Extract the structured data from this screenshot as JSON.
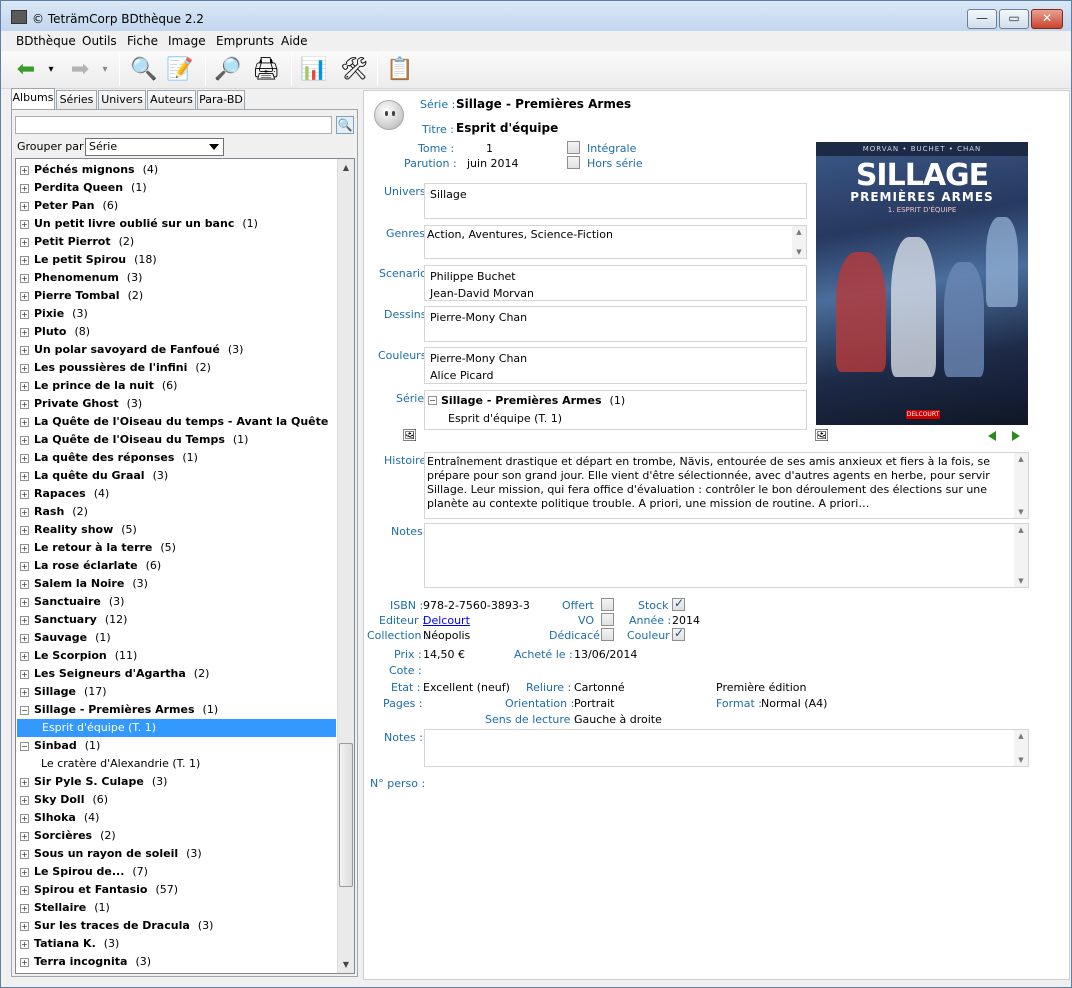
{
  "window": {
    "title": "© TeträmCorp BDthèque 2.2",
    "btn_min": "—",
    "btn_max": "▭",
    "btn_close": "✕"
  },
  "menu": [
    "BDthèque",
    "Outils",
    "Fiche",
    "Image",
    "Emprunts",
    "Aide"
  ],
  "toolbar": {
    "icons": [
      "back-arrow-icon",
      "forward-arrow-icon",
      "search-icon",
      "edit-icon",
      "preview-icon",
      "print-icon",
      "stats-icon",
      "tools-icon",
      "notes-icon"
    ],
    "glyphs": {
      "back": "⬅",
      "back_dd": "▾",
      "forward": "➡",
      "forward_dd": "▾",
      "search": "🔍",
      "edit": "📝",
      "preview": "🔎",
      "print": "🖨",
      "stats": "📊",
      "tools": "🛠",
      "notes": "📋"
    }
  },
  "tabs": [
    "Albums",
    "Séries",
    "Univers",
    "Auteurs",
    "Para-BD"
  ],
  "left": {
    "search_value": "",
    "search_btn": "🔍",
    "group_label": "Grouper par",
    "group_value": "Série",
    "tree": [
      {
        "name": "Péchés mignons",
        "count": "(4)",
        "state": "+"
      },
      {
        "name": "Perdita Queen",
        "count": "(1)",
        "state": "+"
      },
      {
        "name": "Peter Pan",
        "count": "(6)",
        "state": "+"
      },
      {
        "name": "Un petit livre oublié sur un banc",
        "count": "(1)",
        "state": "+"
      },
      {
        "name": "Petit Pierrot",
        "count": "(2)",
        "state": "+"
      },
      {
        "name": "Le petit Spirou",
        "count": "(18)",
        "state": "+"
      },
      {
        "name": "Phenomenum",
        "count": "(3)",
        "state": "+"
      },
      {
        "name": "Pierre Tombal",
        "count": "(2)",
        "state": "+"
      },
      {
        "name": "Pixie",
        "count": "(3)",
        "state": "+"
      },
      {
        "name": "Pluto",
        "count": "(8)",
        "state": "+"
      },
      {
        "name": "Un polar savoyard de Fanfoué",
        "count": "(3)",
        "state": "+"
      },
      {
        "name": "Les poussières de l'infini",
        "count": "(2)",
        "state": "+"
      },
      {
        "name": "Le prince de la nuit",
        "count": "(6)",
        "state": "+"
      },
      {
        "name": "Private Ghost",
        "count": "(3)",
        "state": "+"
      },
      {
        "name": "La Quête de l'Oiseau du temps - Avant la Quête",
        "count": "(4)",
        "state": "+"
      },
      {
        "name": "La Quête de l'Oiseau du Temps",
        "count": "(1)",
        "state": "+"
      },
      {
        "name": "La quête des réponses",
        "count": "(1)",
        "state": "+"
      },
      {
        "name": "La quête du Graal",
        "count": "(3)",
        "state": "+"
      },
      {
        "name": "Rapaces",
        "count": "(4)",
        "state": "+"
      },
      {
        "name": "Rash",
        "count": "(2)",
        "state": "+"
      },
      {
        "name": "Reality show",
        "count": "(5)",
        "state": "+"
      },
      {
        "name": "Le retour à la terre",
        "count": "(5)",
        "state": "+"
      },
      {
        "name": "La rose éclarlate",
        "count": "(6)",
        "state": "+"
      },
      {
        "name": "Salem la Noire",
        "count": "(3)",
        "state": "+"
      },
      {
        "name": "Sanctuaire",
        "count": "(3)",
        "state": "+"
      },
      {
        "name": "Sanctuary",
        "count": "(12)",
        "state": "+"
      },
      {
        "name": "Sauvage",
        "count": "(1)",
        "state": "+"
      },
      {
        "name": "Le Scorpion",
        "count": "(11)",
        "state": "+"
      },
      {
        "name": "Les Seigneurs d'Agartha",
        "count": "(2)",
        "state": "+"
      },
      {
        "name": "Sillage",
        "count": "(17)",
        "state": "+"
      },
      {
        "name": "Sillage - Premières Armes",
        "count": "(1)",
        "state": "-"
      },
      {
        "name": "Esprit d'équipe (T. 1)",
        "count": "",
        "state": "child-selected"
      },
      {
        "name": "Sinbad",
        "count": "(1)",
        "state": "-"
      },
      {
        "name": "Le cratère d'Alexandrie (T. 1)",
        "count": "",
        "state": "child"
      },
      {
        "name": "Sir Pyle S. Culape",
        "count": "(3)",
        "state": "+"
      },
      {
        "name": "Sky Doll",
        "count": "(6)",
        "state": "+"
      },
      {
        "name": "Slhoka",
        "count": "(4)",
        "state": "+"
      },
      {
        "name": "Sorcières",
        "count": "(2)",
        "state": "+"
      },
      {
        "name": "Sous un rayon de soleil",
        "count": "(3)",
        "state": "+"
      },
      {
        "name": "Le Spirou de...",
        "count": "(7)",
        "state": "+"
      },
      {
        "name": "Spirou et Fantasio",
        "count": "(57)",
        "state": "+"
      },
      {
        "name": "Stellaire",
        "count": "(1)",
        "state": "+"
      },
      {
        "name": "Sur les traces de Dracula",
        "count": "(3)",
        "state": "+"
      },
      {
        "name": "Tatiana K.",
        "count": "(3)",
        "state": "+"
      },
      {
        "name": "Terra incognita",
        "count": "(3)",
        "state": "+"
      }
    ]
  },
  "detail": {
    "serie_label": "Série :",
    "serie_value": "Sillage - Premières Armes",
    "titre_label": "Titre :",
    "titre_value": "Esprit d'équipe",
    "tome_label": "Tome :",
    "tome_value": "1",
    "parution_label": "Parution :",
    "parution_value": "juin 2014",
    "integrale_label": "Intégrale",
    "integrale_checked": false,
    "horsserie_label": "Hors série",
    "horsserie_checked": false,
    "univers_label": "Univers",
    "univers": [
      "Sillage"
    ],
    "genres_label": "Genres",
    "genres": "Action, Aventures, Science-Fiction",
    "scenario_label": "Scenario",
    "scenario": [
      "Philippe Buchet",
      "Jean-David Morvan"
    ],
    "dessins_label": "Dessins",
    "dessins": [
      "Pierre-Mony Chan"
    ],
    "couleurs_label": "Couleurs",
    "couleurs": [
      "Pierre-Mony Chan",
      "Alice Picard"
    ],
    "serie_box_label": "Série",
    "serie_box_title": "Sillage - Premières Armes",
    "serie_box_count": "(1)",
    "serie_box_item": "Esprit d'équipe (T. 1)",
    "histoire_label": "Histoire",
    "histoire": "Entraînement drastique et départ en trombe, Nävis, entourée de ses amis anxieux et fiers à la fois, se prépare pour son grand jour. Elle vient d'être sélectionnée, avec d'autres agents en herbe, pour servir Sillage. Leur mission, qui fera office d'évaluation : contrôler le bon déroulement des élections sur une planète au contexte politique trouble. A priori, une mission de routine. A priori…",
    "notes_label": "Notes",
    "notes": "",
    "isbn_label": "ISBN :",
    "isbn": "978-2-7560-3893-3",
    "editeur_label": "Editeur :",
    "editeur": "Delcourt",
    "collection_label": "Collection :",
    "collection": "Néopolis",
    "offert_label": "Offert",
    "offert": false,
    "vo_label": "VO",
    "vo": false,
    "dedicace_label": "Dédicacé",
    "dedicace": false,
    "stock_label": "Stock",
    "stock": true,
    "annee_label": "Année :",
    "annee": "2014",
    "couleur_label": "Couleur",
    "couleur": true,
    "prix_label": "Prix :",
    "prix": "14,50 €",
    "achete_label": "Acheté le :",
    "achete": "13/06/2014",
    "cote_label": "Cote :",
    "cote": "",
    "etat_label": "Etat :",
    "etat": "Excellent (neuf)",
    "reliure_label": "Reliure :",
    "reliure": "Cartonné",
    "edition": "Première édition",
    "pages_label": "Pages :",
    "pages": "",
    "orientation_label": "Orientation :",
    "orientation": "Portrait",
    "format_label": "Format :",
    "format": "Normal (A4)",
    "sens_label": "Sens de lecture :",
    "sens": "Gauche à droite",
    "notes2_label": "Notes :",
    "notes2": "",
    "nperso_label": "N° perso :",
    "nperso": ""
  },
  "cover": {
    "header": "MORVAN • BUCHET • CHAN",
    "title": "SILLAGE",
    "subtitle": "PREMIÈRES ARMES",
    "tagline": "1. ESPRIT D'ÉQUIPE",
    "publisher": "DELCOURT"
  }
}
